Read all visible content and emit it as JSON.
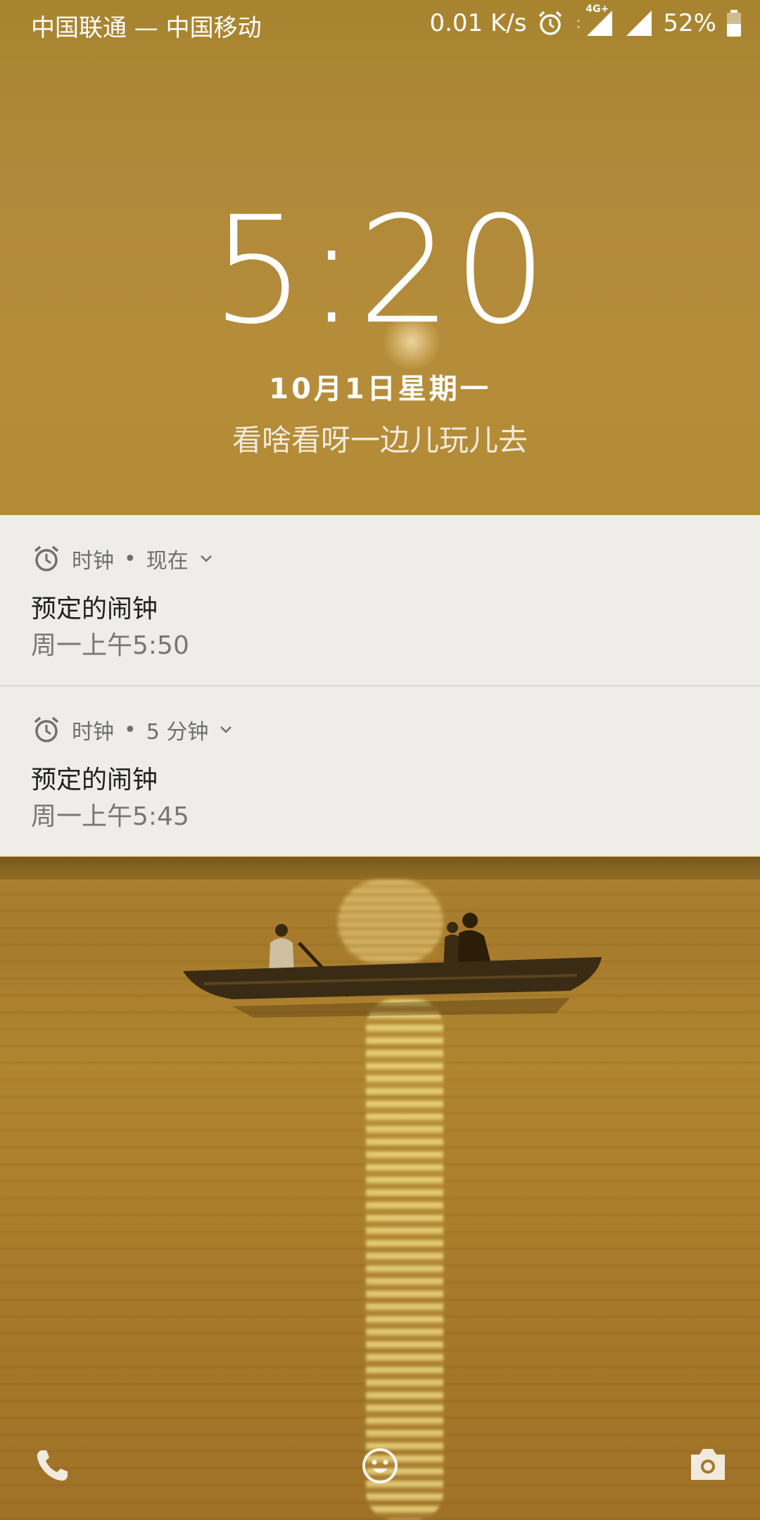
{
  "status_bar": {
    "carrier": "中国联通 — 中国移动",
    "network_speed": "0.01 K/s",
    "network_type": "4G+",
    "battery": "52%",
    "icons": [
      "alarm-icon",
      "signal-icon",
      "signal-icon",
      "battery-icon"
    ]
  },
  "lockscreen": {
    "time": "5:20",
    "date": "10月1日星期一",
    "owner_info": "看啥看呀一边儿玩儿去"
  },
  "notifications": [
    {
      "app": "时钟",
      "separator": "•",
      "when": "现在",
      "title": "预定的闹钟",
      "text": "周一上午5:50",
      "icon": "alarm-clock-icon"
    },
    {
      "app": "时钟",
      "separator": "•",
      "when": "5 分钟",
      "title": "预定的闹钟",
      "text": "周一上午5:45",
      "icon": "alarm-clock-icon"
    }
  ],
  "bottom_bar": {
    "left": "phone-icon",
    "center": "emoji-icon",
    "right": "camera-icon"
  },
  "colors": {
    "notification_bg": "#eeedea",
    "wallpaper_tone": "#b08a36"
  }
}
